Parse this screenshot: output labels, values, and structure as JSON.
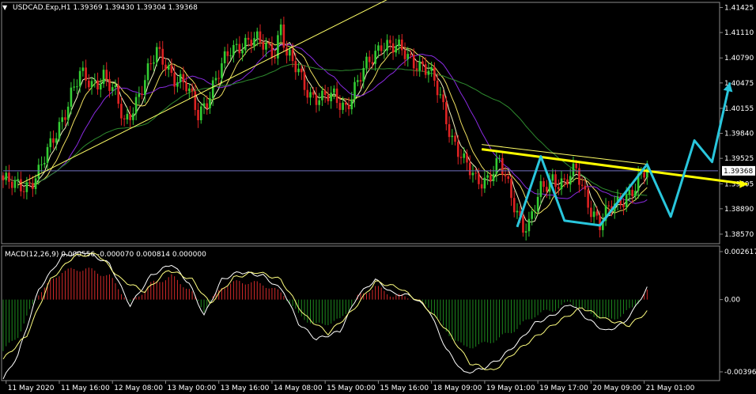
{
  "chart_data": [
    {
      "type": "candlestick",
      "title": "USDCAD.Exp,H1  1.39369 1.39430 1.39304 1.39368",
      "symbol": "USDCAD.Exp,H1",
      "ohlc_text": "1.39369 1.39430 1.39304 1.39368",
      "ylim": [
        1.3848,
        1.4148
      ],
      "y_ticks": [
        1.41425,
        1.4111,
        1.4079,
        1.40475,
        1.40155,
        1.3984,
        1.39525,
        1.39205,
        1.3889,
        1.3857
      ],
      "y_tick_labels": [
        "1.41425",
        "1.41110",
        "1.40790",
        "1.40475",
        "1.40155",
        "1.39840",
        "1.39525",
        "1.39205",
        "1.38890",
        "1.38570"
      ],
      "current_price": 1.39368,
      "current_price_label": "1.39368",
      "close_path": [
        [
          0,
          1.3925
        ],
        [
          4,
          1.3915
        ],
        [
          8,
          1.392
        ],
        [
          12,
          1.3935
        ],
        [
          16,
          1.3965
        ],
        [
          20,
          1.4005
        ],
        [
          23,
          1.4035
        ],
        [
          26,
          1.4055
        ],
        [
          30,
          1.4045
        ],
        [
          34,
          1.406
        ],
        [
          38,
          1.403
        ],
        [
          41,
          1.3995
        ],
        [
          44,
          1.402
        ],
        [
          48,
          1.405
        ],
        [
          52,
          1.4085
        ],
        [
          55,
          1.4075
        ],
        [
          58,
          1.4055
        ],
        [
          62,
          1.404
        ],
        [
          66,
          1.401
        ],
        [
          70,
          1.4035
        ],
        [
          74,
          1.4065
        ],
        [
          77,
          1.409
        ],
        [
          80,
          1.4098
        ],
        [
          84,
          1.41
        ],
        [
          88,
          1.4095
        ],
        [
          92,
          1.409
        ],
        [
          94,
          1.412
        ],
        [
          96,
          1.408
        ],
        [
          100,
          1.406
        ],
        [
          104,
          1.4035
        ],
        [
          108,
          1.4025
        ],
        [
          112,
          1.403
        ],
        [
          116,
          1.402
        ],
        [
          120,
          1.4045
        ],
        [
          124,
          1.4075
        ],
        [
          128,
          1.41
        ],
        [
          132,
          1.409
        ],
        [
          136,
          1.4085
        ],
        [
          140,
          1.4075
        ],
        [
          144,
          1.406
        ],
        [
          148,
          1.403
        ],
        [
          152,
          1.398
        ],
        [
          156,
          1.3945
        ],
        [
          160,
          1.3925
        ],
        [
          164,
          1.393
        ],
        [
          168,
          1.3945
        ],
        [
          172,
          1.3905
        ],
        [
          176,
          1.387
        ],
        [
          178,
          1.3868
        ],
        [
          182,
          1.391
        ],
        [
          186,
          1.393
        ],
        [
          190,
          1.392
        ],
        [
          194,
          1.3935
        ],
        [
          198,
          1.39
        ],
        [
          202,
          1.3868
        ],
        [
          206,
          1.389
        ],
        [
          210,
          1.3905
        ],
        [
          214,
          1.3915
        ],
        [
          218,
          1.3937
        ]
      ],
      "bar_count": 219,
      "visible_range": [
        0,
        242
      ],
      "x_tick_labels": [
        {
          "bar": 1,
          "label": "11 May 2020"
        },
        {
          "bar": 19,
          "label": "11 May 16:00"
        },
        {
          "bar": 37,
          "label": "12 May 08:00"
        },
        {
          "bar": 55,
          "label": "13 May 00:00"
        },
        {
          "bar": 73,
          "label": "13 May 16:00"
        },
        {
          "bar": 91,
          "label": "14 May 08:00"
        },
        {
          "bar": 109,
          "label": "15 May 00:00"
        },
        {
          "bar": 127,
          "label": "15 May 16:00"
        },
        {
          "bar": 145,
          "label": "18 May 09:00"
        },
        {
          "bar": 163,
          "label": "19 May 01:00"
        },
        {
          "bar": 181,
          "label": "19 May 17:00"
        },
        {
          "bar": 199,
          "label": "20 May 09:00"
        },
        {
          "bar": 217,
          "label": "21 May 01:00"
        }
      ],
      "moving_averages": [
        {
          "color": "#f5f5c0",
          "period": 5
        },
        {
          "color": "#f0e060",
          "period": 10
        },
        {
          "color": "#8a2be2",
          "period": 20
        },
        {
          "color": "#2e8b2e",
          "period": 50
        }
      ],
      "annotations": {
        "trendlines": [
          {
            "color": "#ffff66",
            "points": [
              [
                5,
                1.3919
              ],
              [
                134,
                1.416
              ]
            ]
          },
          {
            "color": "#ffff66",
            "points": [
              [
                162,
                1.397
              ],
              [
                218,
                1.3945
              ]
            ]
          },
          {
            "color": "#ffff00",
            "points": [
              [
                162,
                1.3964
              ],
              [
                252,
                1.392
              ]
            ],
            "arrow": true
          }
        ],
        "wave_projection": {
          "color": "#29c6dc",
          "points": [
            [
              174,
              1.3866
            ],
            [
              182,
              1.3955
            ],
            [
              190,
              1.3874
            ],
            [
              202,
              1.3868
            ],
            [
              218,
              1.3945
            ],
            [
              226,
              1.3879
            ],
            [
              234,
              1.3975
            ],
            [
              240,
              1.3948
            ],
            [
              246,
              1.4048
            ]
          ]
        }
      }
    },
    {
      "type": "macd",
      "title": "MACD(12,26,9) 0.000556 -0.000070 0.000814 0.000000",
      "ylim": [
        -0.003961,
        0.002617
      ],
      "y_tick_labels": [
        "0.002617",
        "0.00",
        "-0.003961"
      ],
      "macd_path": [
        [
          0,
          -0.004
        ],
        [
          5,
          -0.0028
        ],
        [
          12,
          0.0005
        ],
        [
          20,
          0.0022
        ],
        [
          28,
          0.0024
        ],
        [
          36,
          0.0018
        ],
        [
          43,
          -0.0003
        ],
        [
          50,
          0.0012
        ],
        [
          57,
          0.0018
        ],
        [
          63,
          0.0008
        ],
        [
          68,
          -0.0008
        ],
        [
          74,
          0.001
        ],
        [
          80,
          0.0014
        ],
        [
          88,
          0.0012
        ],
        [
          95,
          0.0004
        ],
        [
          100,
          -0.0012
        ],
        [
          106,
          -0.002
        ],
        [
          114,
          -0.0016
        ],
        [
          120,
          0.0002
        ],
        [
          126,
          0.001
        ],
        [
          132,
          0.0003
        ],
        [
          138,
          0.0002
        ],
        [
          144,
          -0.0005
        ],
        [
          150,
          -0.0025
        ],
        [
          156,
          -0.0037
        ],
        [
          162,
          -0.0035
        ],
        [
          168,
          -0.003
        ],
        [
          174,
          -0.0022
        ],
        [
          180,
          -0.0012
        ],
        [
          186,
          -0.0008
        ],
        [
          192,
          -0.0002
        ],
        [
          198,
          -0.001
        ],
        [
          204,
          -0.0016
        ],
        [
          210,
          -0.0012
        ],
        [
          214,
          -0.0004
        ],
        [
          218,
          0.0006
        ]
      ],
      "signal_path": [
        [
          0,
          -0.003
        ],
        [
          8,
          -0.0018
        ],
        [
          16,
          0.001
        ],
        [
          24,
          0.0022
        ],
        [
          32,
          0.0023
        ],
        [
          40,
          0.001
        ],
        [
          48,
          0.0004
        ],
        [
          56,
          0.0015
        ],
        [
          64,
          0.001
        ],
        [
          70,
          -0.0002
        ],
        [
          78,
          0.0011
        ],
        [
          86,
          0.0014
        ],
        [
          94,
          0.001
        ],
        [
          102,
          -0.0008
        ],
        [
          110,
          -0.0017
        ],
        [
          118,
          -0.0006
        ],
        [
          126,
          0.0009
        ],
        [
          134,
          0.0006
        ],
        [
          142,
          -0.0002
        ],
        [
          150,
          -0.0015
        ],
        [
          158,
          -0.0032
        ],
        [
          166,
          -0.0036
        ],
        [
          172,
          -0.0028
        ],
        [
          180,
          -0.0019
        ],
        [
          188,
          -0.0011
        ],
        [
          196,
          -0.0004
        ],
        [
          204,
          -0.001
        ],
        [
          212,
          -0.0013
        ],
        [
          218,
          -0.0006
        ]
      ],
      "colors": {
        "up": "#d42a2a",
        "down": "#1e8a1e",
        "macd": "#ffffff",
        "signal": "#ffff80"
      }
    }
  ]
}
